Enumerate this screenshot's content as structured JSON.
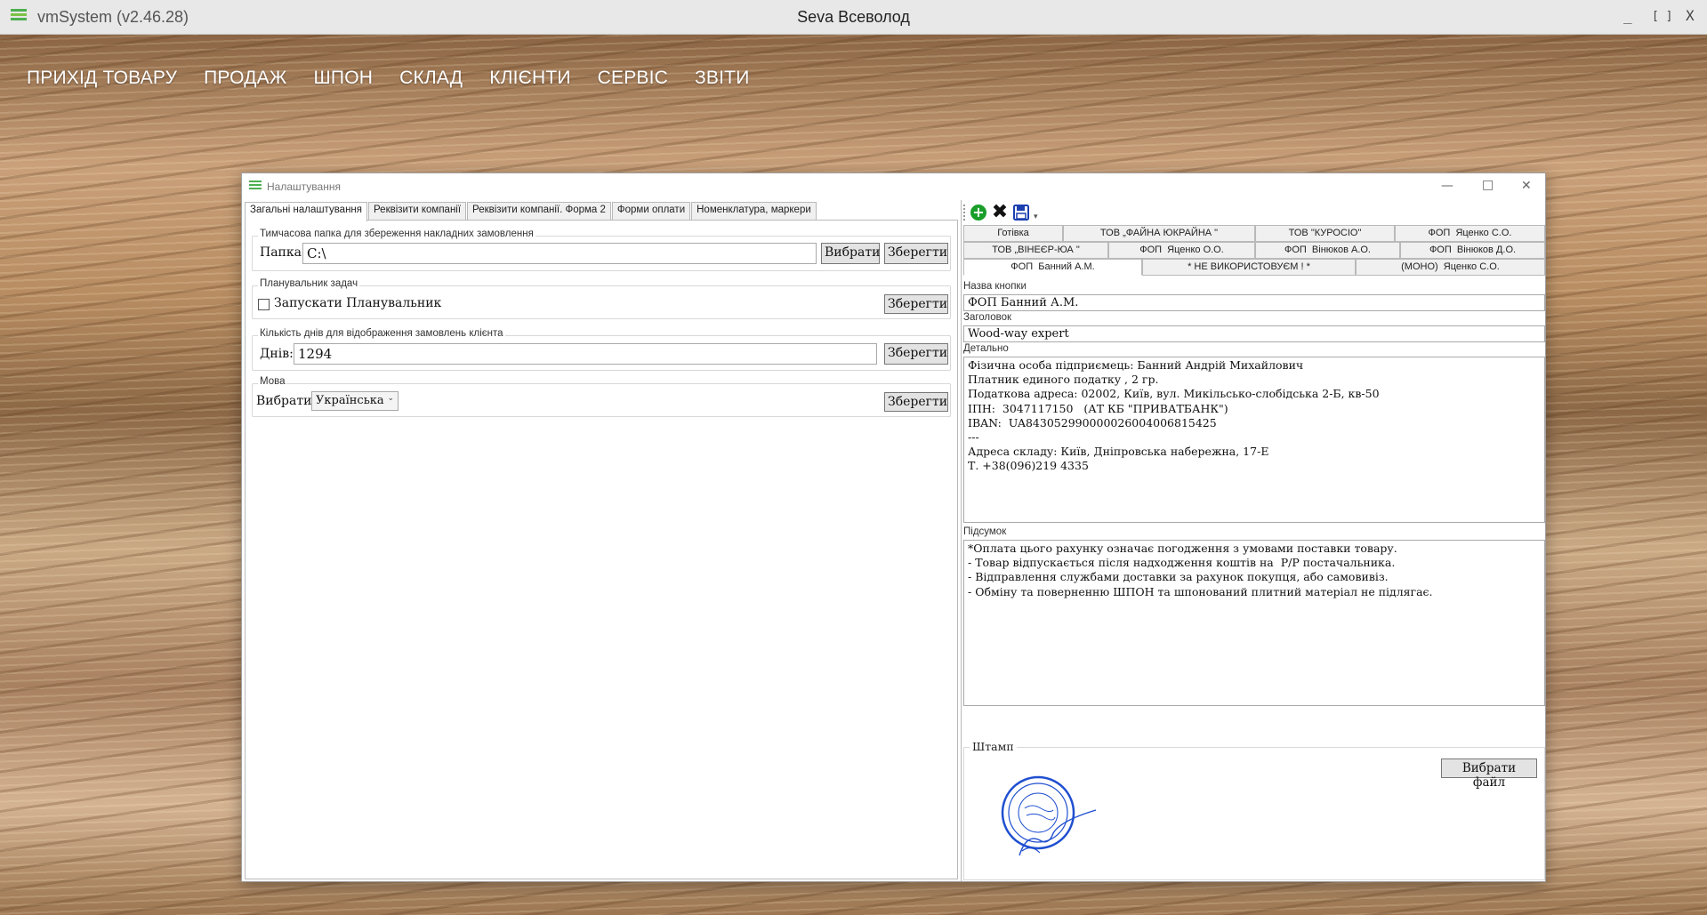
{
  "app": {
    "title": "vmSystem (v2.46.28)",
    "user": "Seva Всеволод",
    "controls": {
      "minimize": "_",
      "maximize": "[ ]",
      "close": "X"
    }
  },
  "nav": [
    "ПРИХІД ТОВАРУ",
    "ПРОДАЖ",
    "ШПОН",
    "СКЛАД",
    "КЛІЄНТИ",
    "СЕРВІС",
    "ЗВІТИ"
  ],
  "dialog": {
    "title": "Налаштування",
    "tabs": [
      "Загальні налаштування",
      "Реквізити компанії",
      "Реквізити компанії. Форма 2",
      "Форми оплати",
      "Номенклатура, маркери"
    ],
    "active_tab": 0,
    "temp_folder": {
      "legend": "Тимчасова папка для збереження накладних замовлення",
      "label": "Папка:",
      "value": "C:\\",
      "browse": "Вибрати",
      "save": "Зберегти"
    },
    "scheduler": {
      "legend": "Планувальник задач",
      "checkbox_label": "Запускати Планувальник",
      "checked": false,
      "save": "Зберегти"
    },
    "days": {
      "legend": "Кількість днів для відображення замовлень клієнта",
      "label": "Днів:",
      "value": "1294",
      "save": "Зберегти"
    },
    "language": {
      "legend": "Мова",
      "label": "Вибрати:",
      "value": "Українська",
      "save": "Зберегти"
    }
  },
  "right": {
    "company_tabs_row1": [
      "Готівка",
      "ТОВ „ФАЙНА ЮКРАЙНА \"",
      "ТОВ \"КУРОСІО\"",
      "ФОП  Яценко С.О."
    ],
    "company_tabs_row2": [
      "ТОВ „ВІНЕЄР-ЮА \"",
      "ФОП  Яценко О.О.",
      "ФОП  Вінюков А.О.",
      "ФОП  Вінюков Д.О."
    ],
    "company_tabs_row3": [
      "ФОП  Банний А.М.",
      "* НЕ ВИКОРИСТОВУЄМ ! *",
      "(МОНО)  Яценко С.О."
    ],
    "active_company": "ФОП  Банний А.М.",
    "button_name_label": "Назва кнопки",
    "button_name": "ФОП  Банний А.М.",
    "header_label": "Заголовок",
    "header": "Wood-way expert",
    "details_label": "Детально",
    "details": "Фізична особа підприємець: Банний Андрій Михайлович\nПлатник единого податку , 2 гр.\nПодаткова адреса: 02002, Київ, вул. Микільсько-слобідська 2-Б, кв-50\nІПН:  3047117150   (АТ КБ \"ПРИВАТБАНК\")\nIBAN:  UA843052990000026004006815425\n---\nАдреса складу: Київ, Дніпровська набережна, 17-Е\nТ. +38(096)219 4335",
    "summary_label": "Підсумок",
    "summary": "*Оплата цього рахунку означає погодження з умовами поставки товару.\n- Товар відпускається після надходження коштів на  Р/Р постачальника.\n- Відправлення службами доставки за рахунок покупця, або самовивіз.\n- Обміну та поверненню ШПОН та шпонований плитний матеріал не підлягає.",
    "stamp_label": "Штамп",
    "choose_file": "Вибрати файл",
    "stamp_text": "БАННИЙ Андрій Михайлович"
  },
  "colors": {
    "accent_green": "#1a9e2a",
    "stamp_blue": "#1f4fd0",
    "save_blue": "#1a3fb0"
  }
}
